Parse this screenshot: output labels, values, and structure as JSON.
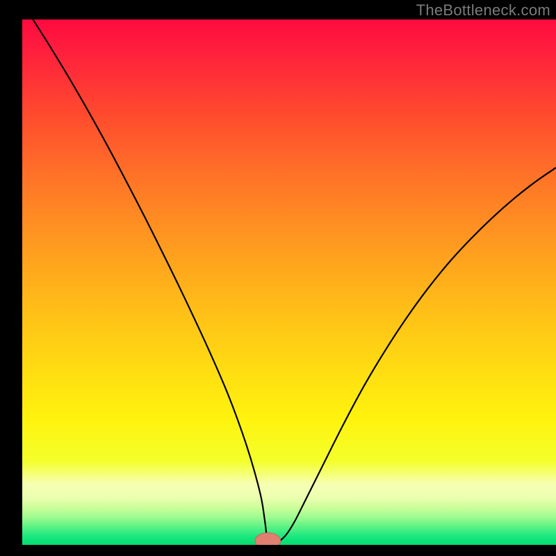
{
  "watermark": "TheBottleneck.com",
  "colors": {
    "frame": "#000000",
    "watermark": "#7b7b7b",
    "curve": "#000000",
    "marker_fill": "#e08070",
    "marker_stroke": "#d06050",
    "gradient_stops": [
      {
        "offset": 0.0,
        "color": "#ff0a3f"
      },
      {
        "offset": 0.06,
        "color": "#ff1f3d"
      },
      {
        "offset": 0.18,
        "color": "#ff4a2e"
      },
      {
        "offset": 0.3,
        "color": "#ff7327"
      },
      {
        "offset": 0.42,
        "color": "#ff9820"
      },
      {
        "offset": 0.54,
        "color": "#ffbb18"
      },
      {
        "offset": 0.66,
        "color": "#ffdb12"
      },
      {
        "offset": 0.76,
        "color": "#fff30e"
      },
      {
        "offset": 0.84,
        "color": "#f4ff2a"
      },
      {
        "offset": 0.885,
        "color": "#f6ffb4"
      },
      {
        "offset": 0.91,
        "color": "#ecffb0"
      },
      {
        "offset": 0.93,
        "color": "#c9fe99"
      },
      {
        "offset": 0.948,
        "color": "#9cfb90"
      },
      {
        "offset": 0.965,
        "color": "#5ef284"
      },
      {
        "offset": 0.985,
        "color": "#17e77f"
      },
      {
        "offset": 1.0,
        "color": "#05dc6e"
      }
    ]
  },
  "chart_data": {
    "type": "line",
    "title": "",
    "xlabel": "",
    "ylabel": "",
    "xlim": [
      0,
      100
    ],
    "ylim": [
      0,
      100
    ],
    "grid": false,
    "legend": false,
    "marker": {
      "x": 46,
      "y": 0,
      "rx": 2.4,
      "ry": 1.5
    },
    "series": [
      {
        "name": "bottleneck-curve",
        "x": [
          2,
          5,
          8,
          11,
          14,
          17,
          20,
          23,
          26,
          29,
          32,
          35,
          38,
          40,
          42,
          43.5,
          44.8,
          45.5,
          46,
          47,
          48.2,
          49.5,
          51,
          53,
          56,
          60,
          64,
          68,
          72,
          76,
          80,
          84,
          88,
          92,
          96,
          100
        ],
        "y": [
          100,
          95.2,
          90.2,
          85.0,
          79.6,
          74.0,
          68.2,
          62.3,
          56.2,
          50.0,
          43.6,
          37.0,
          30.0,
          24.8,
          19.0,
          14.0,
          8.8,
          4.2,
          0.6,
          0,
          0.7,
          2.0,
          4.4,
          8.4,
          14.5,
          22.6,
          30.2,
          37.0,
          43.2,
          48.8,
          53.8,
          58.2,
          62.2,
          65.8,
          69.0,
          71.8
        ]
      }
    ]
  }
}
